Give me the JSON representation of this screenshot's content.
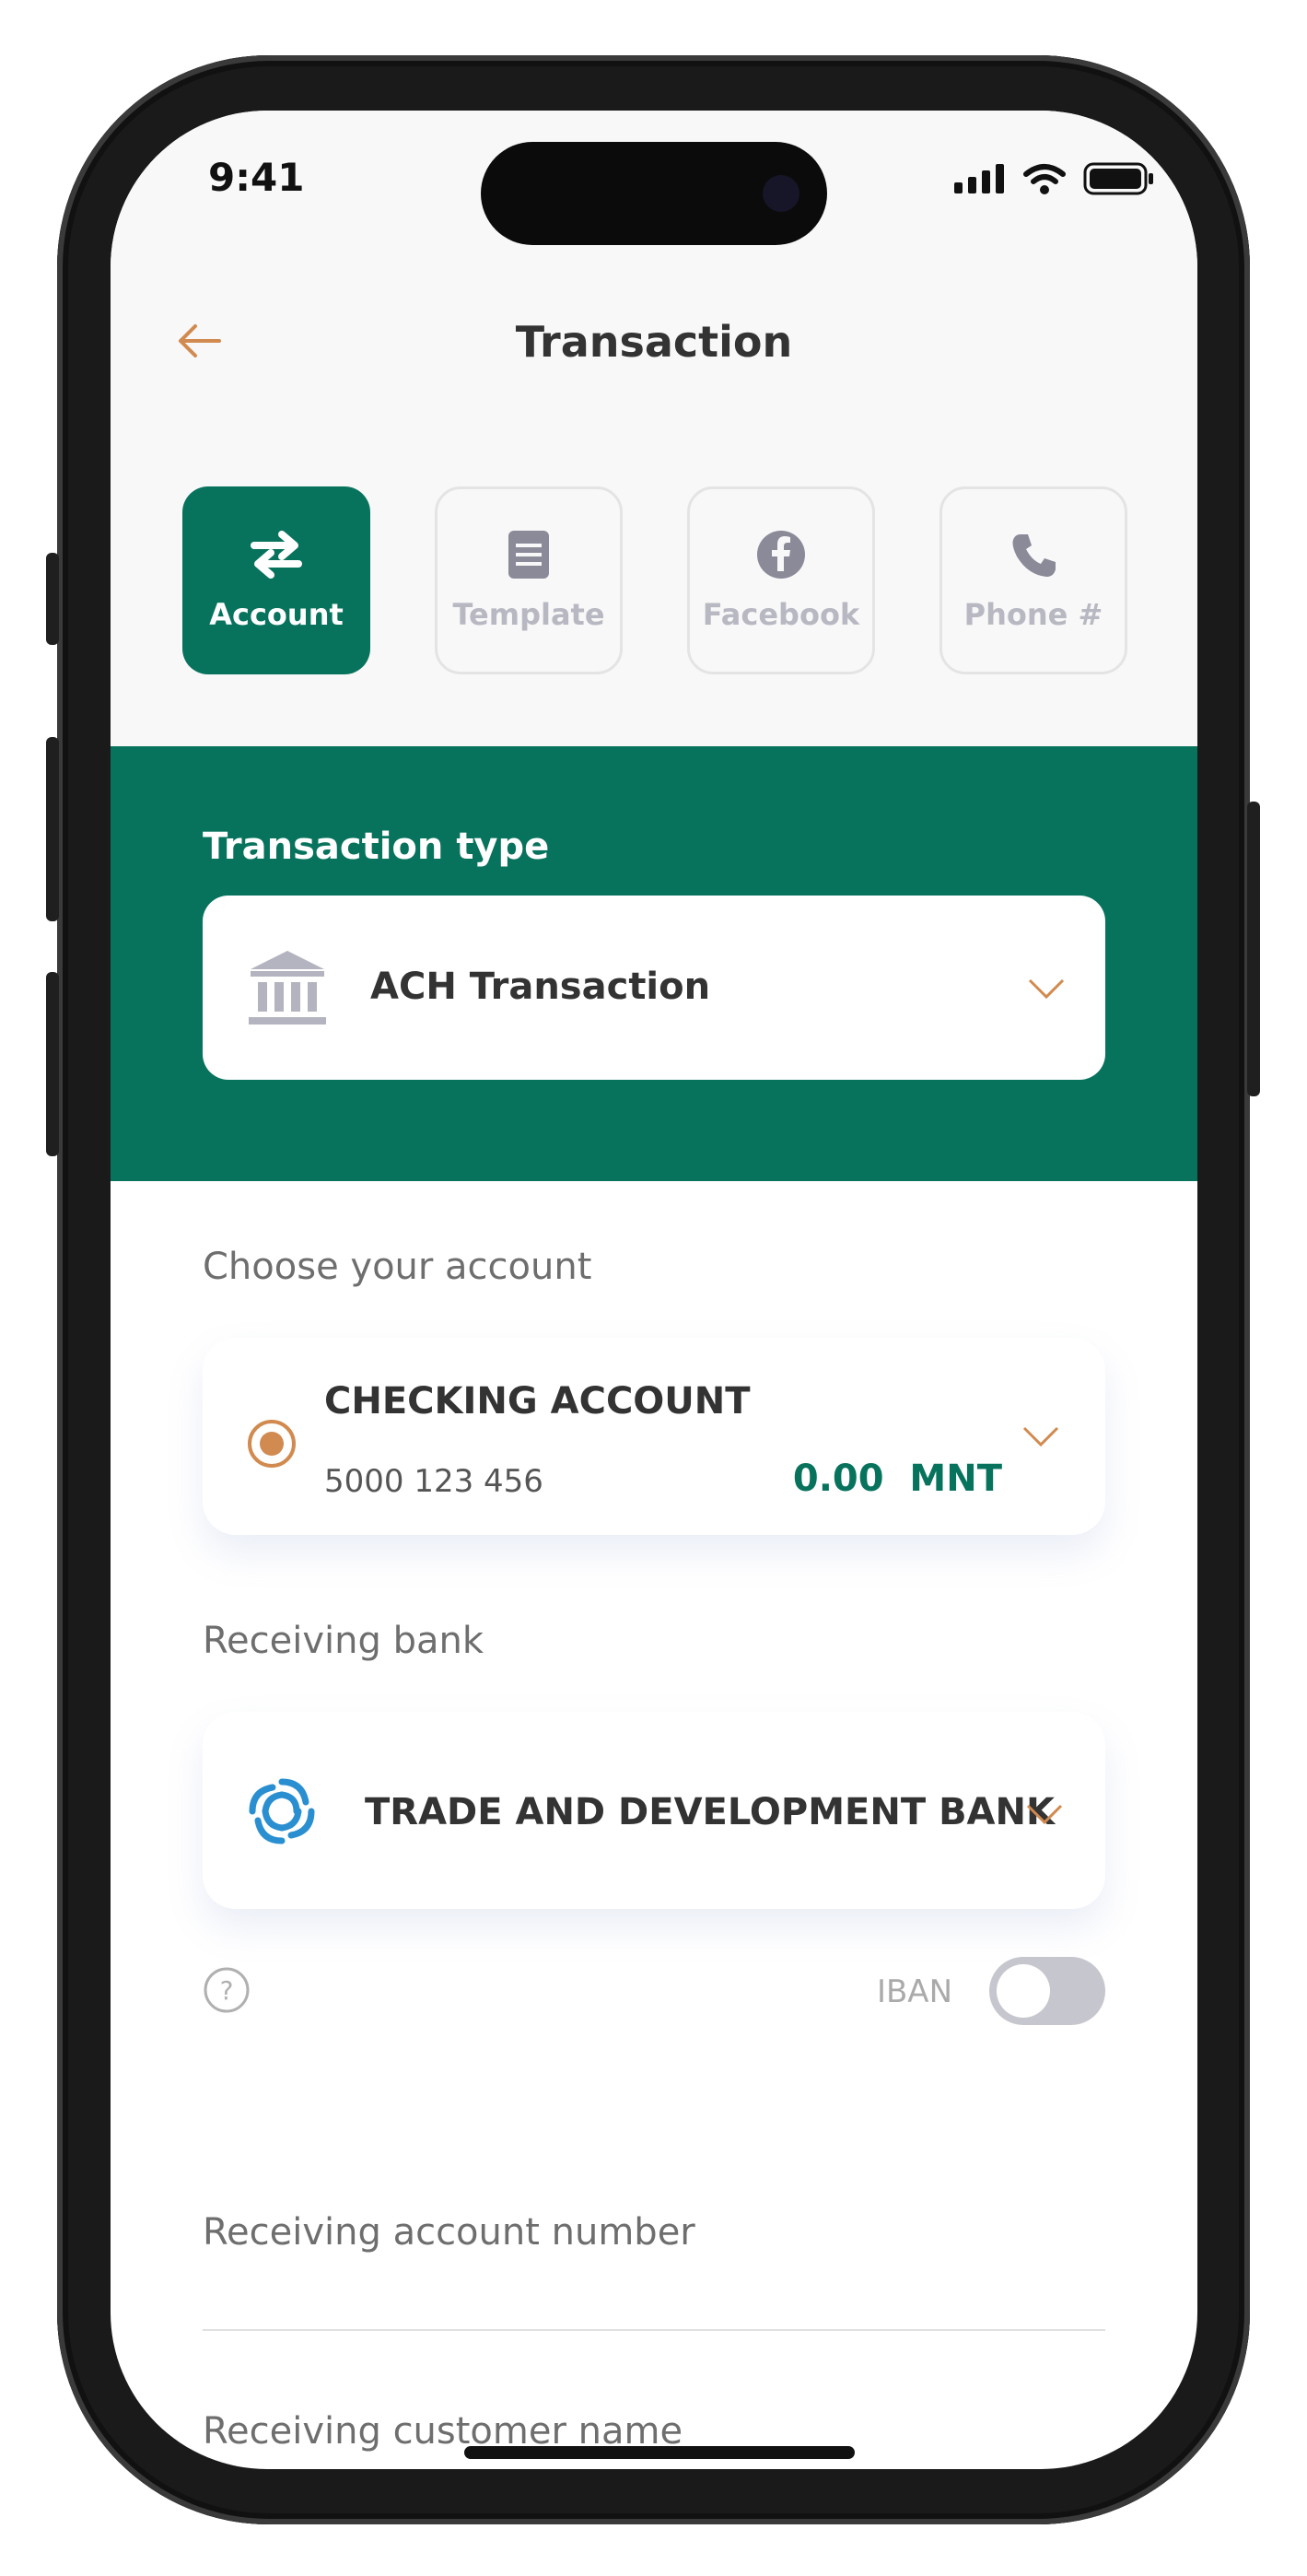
{
  "status": {
    "time": "9:41"
  },
  "header": {
    "title": "Transaction"
  },
  "tabs": [
    {
      "label": "Account",
      "icon": "transfer-arrows-icon",
      "active": true
    },
    {
      "label": "Template",
      "icon": "document-icon",
      "active": false
    },
    {
      "label": "Facebook",
      "icon": "facebook-icon",
      "active": false
    },
    {
      "label": "Phone #",
      "icon": "phone-icon",
      "active": false
    }
  ],
  "transaction_type": {
    "label": "Transaction type",
    "value": "ACH Transaction",
    "icon": "bank-building-icon"
  },
  "account": {
    "label": "Choose your account",
    "name": "CHECKING ACCOUNT",
    "number": "5000 123 456",
    "balance": "0.00  MNT"
  },
  "receiving_bank": {
    "label": "Receiving bank",
    "name": "TRADE AND DEVELOPMENT BANK",
    "icon": "tdb-logo-icon"
  },
  "iban": {
    "label": "IBAN",
    "enabled": false
  },
  "fields": {
    "account_number_placeholder": "Receiving account number",
    "customer_name_placeholder": "Receiving customer name"
  },
  "colors": {
    "primary": "#08735d",
    "accent": "#d18a4f",
    "text": "#333333"
  }
}
